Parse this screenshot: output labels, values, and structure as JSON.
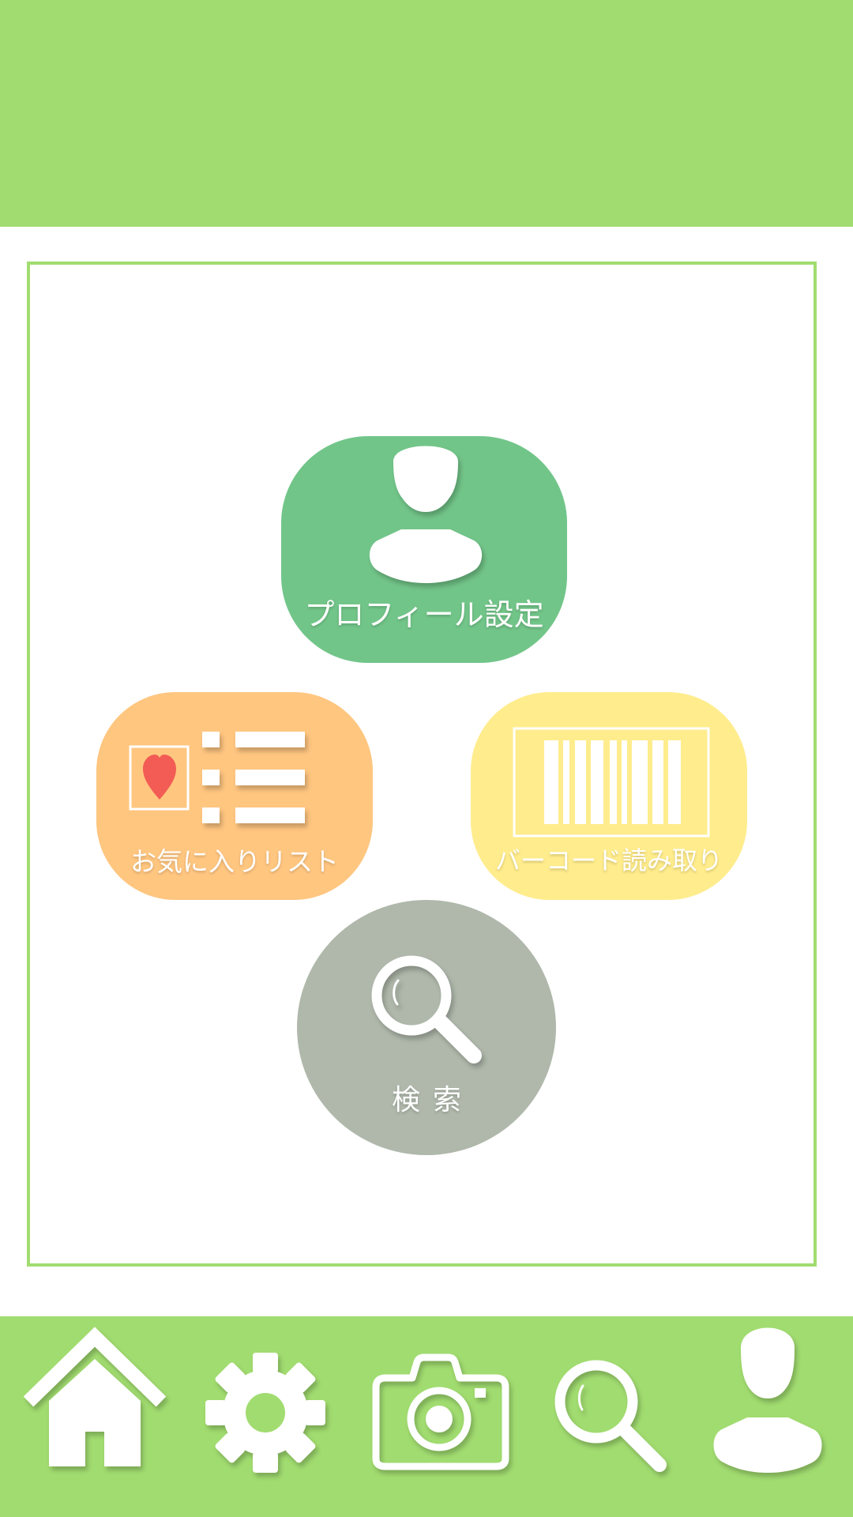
{
  "menu": {
    "profile": {
      "label": "プロフィール設定",
      "icon": "user-icon",
      "color": "#72c589"
    },
    "favorites": {
      "label": "お気に入りリスト",
      "icon": "favorite-list-icon",
      "color": "#ffc680"
    },
    "barcode": {
      "label": "バーコード読み取り",
      "icon": "barcode-icon",
      "color": "#ffec8c"
    },
    "search": {
      "label": "検索",
      "icon": "magnifier-icon",
      "color": "#afb8ab"
    }
  },
  "nav": {
    "items": [
      {
        "name": "home",
        "icon": "home-icon"
      },
      {
        "name": "settings",
        "icon": "gear-icon"
      },
      {
        "name": "camera",
        "icon": "camera-icon"
      },
      {
        "name": "search",
        "icon": "search-icon"
      },
      {
        "name": "profile",
        "icon": "user-icon"
      }
    ]
  },
  "colors": {
    "accent": "#a1dc70",
    "heart": "#f25c54",
    "white": "#ffffff"
  }
}
